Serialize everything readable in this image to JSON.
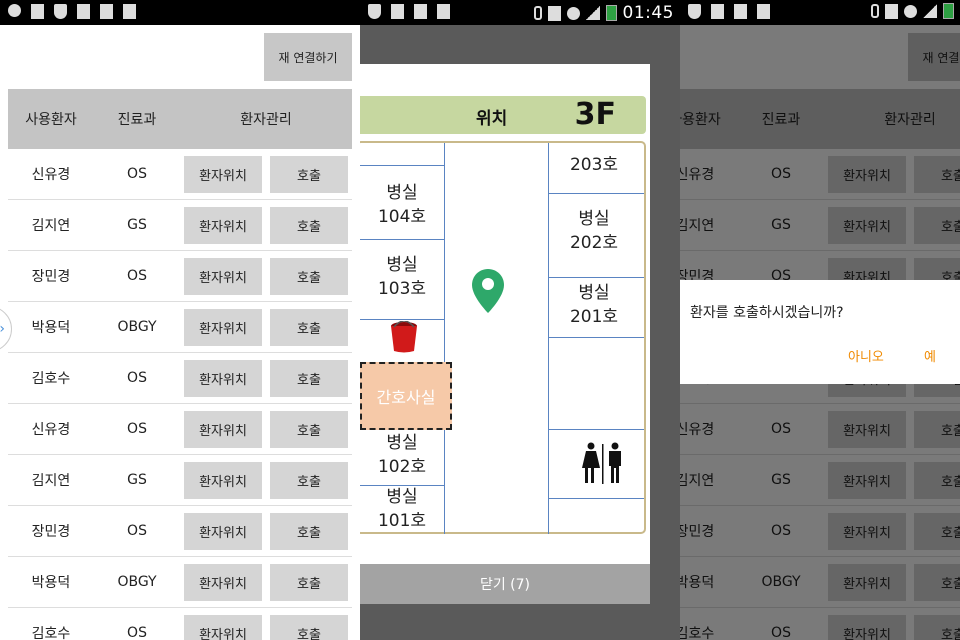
{
  "status_bar": {
    "time": "01:45"
  },
  "list_screen": {
    "reconnect_label": "재 연결하기",
    "headers": {
      "patient": "사용환자",
      "dept": "진료과",
      "manage": "환자관리"
    },
    "location_label": "환자위치",
    "call_label": "호출",
    "rows": [
      {
        "name": "신유경",
        "dept": "OS"
      },
      {
        "name": "김지연",
        "dept": "GS"
      },
      {
        "name": "장민경",
        "dept": "OS"
      },
      {
        "name": "박용덕",
        "dept": "OBGY"
      },
      {
        "name": "김호수",
        "dept": "OS"
      },
      {
        "name": "신유경",
        "dept": "OS"
      },
      {
        "name": "김지연",
        "dept": "GS"
      },
      {
        "name": "장민경",
        "dept": "OS"
      },
      {
        "name": "박용덕",
        "dept": "OBGY"
      },
      {
        "name": "김호수",
        "dept": "OS"
      }
    ]
  },
  "map_dialog": {
    "title": "위치",
    "floor": "3F",
    "rooms": {
      "r104": [
        "병실",
        "104호"
      ],
      "r103": [
        "병실",
        "103호"
      ],
      "r102": [
        "병실",
        "102호"
      ],
      "r101": [
        "병실",
        "101호"
      ],
      "r203": "203호",
      "r202": [
        "병실",
        "202호"
      ],
      "r201": [
        "병실",
        "201호"
      ]
    },
    "nurse_station": "간호사실",
    "close_label": "닫기 (7)"
  },
  "confirm_dialog": {
    "message": "환자를 호출하시겠습니까?",
    "no_label": "아니오",
    "yes_label": "예"
  },
  "colors": {
    "title_bg": "#c6d7a0",
    "nurse_bg": "#f6c9a8",
    "pin": "#2ea86a",
    "accent": "#f08a00",
    "wall": "#5a84c2"
  }
}
